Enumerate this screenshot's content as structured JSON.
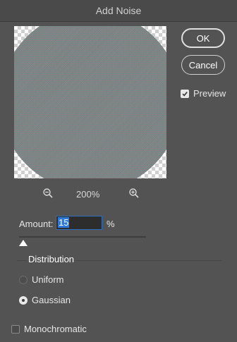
{
  "window": {
    "title": "Add Noise"
  },
  "preview": {
    "zoom": "200%",
    "zoom_out_icon": "zoom-out-icon",
    "zoom_in_icon": "zoom-in-icon"
  },
  "buttons": {
    "ok": "OK",
    "cancel": "Cancel"
  },
  "preview_toggle": {
    "label": "Preview",
    "checked": true
  },
  "amount": {
    "label": "Amount:",
    "value": "15",
    "unit": "%",
    "slider_value_fraction": 0.15
  },
  "distribution": {
    "label": "Distribution",
    "options": [
      {
        "label": "Uniform",
        "selected": false
      },
      {
        "label": "Gaussian",
        "selected": true
      }
    ]
  },
  "monochromatic": {
    "label": "Monochromatic",
    "checked": false
  },
  "colors": {
    "panel": "#535353",
    "accent": "#2f79d8"
  }
}
